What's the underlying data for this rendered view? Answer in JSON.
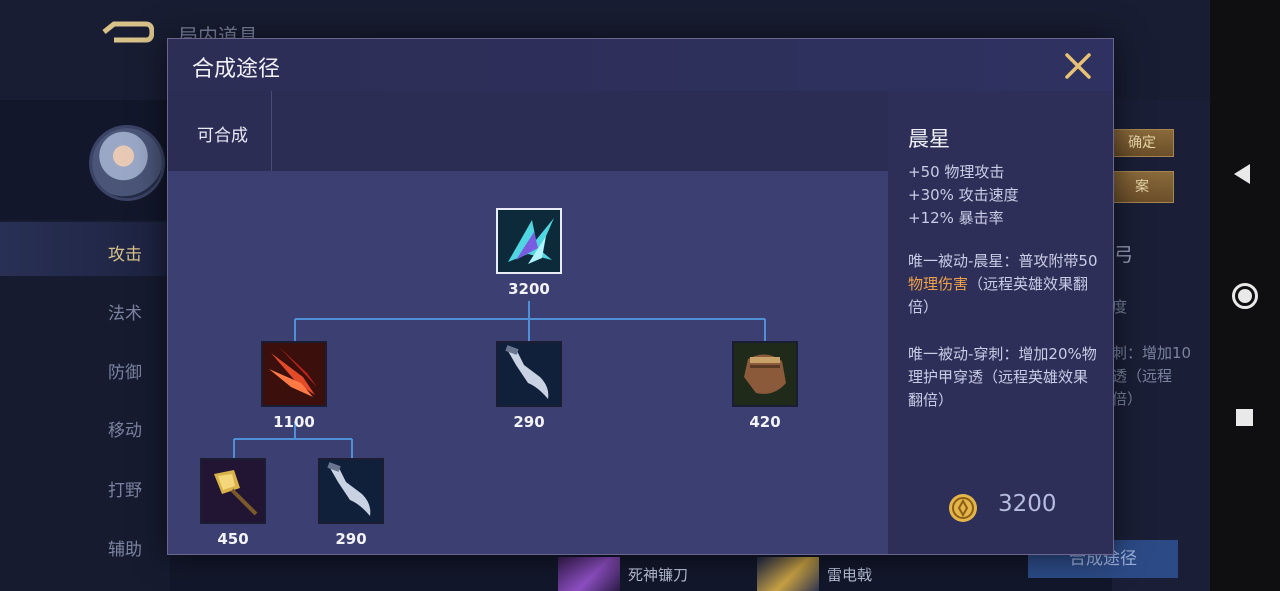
{
  "background": {
    "title": "局内道具",
    "categories": [
      "攻击",
      "法术",
      "防御",
      "移动",
      "打野",
      "辅助"
    ],
    "confirm_label": "确定",
    "plan_label": "案",
    "right_name_fragment": "弓",
    "right_stat_fragment": "度",
    "right_desc_fragments": [
      "刺：增加10",
      "透（远程",
      "倍）"
    ],
    "synth_button": "合成途径",
    "bottom_items": [
      {
        "name": "死神镰刀",
        "icon": "sickle-item-icon"
      },
      {
        "name": "雷电戟",
        "icon": "thunder-halberd-item-icon"
      }
    ]
  },
  "modal": {
    "title": "合成途径",
    "tab_label": "可合成",
    "item": {
      "name": "晨星",
      "stats": [
        "+50 物理攻击",
        "+30% 攻击速度",
        "+12% 暴击率"
      ],
      "passive1": {
        "prefix": "唯一被动-晨星：普攻附带50",
        "highlight": "物理伤害",
        "suffix": "（远程英雄效果翻倍）"
      },
      "passive2": "唯一被动-穿刺：增加20%物理护甲穿透（远程英雄效果翻倍）",
      "price": "3200"
    },
    "tree": {
      "root": {
        "icon": "morning-star-icon",
        "price": "3200"
      },
      "children": [
        {
          "icon": "red-claw-blade-icon",
          "price": "1100",
          "children": [
            {
              "icon": "golden-hammer-icon",
              "price": "450"
            },
            {
              "icon": "curved-dagger-icon",
              "price": "290"
            }
          ]
        },
        {
          "icon": "curved-dagger-icon",
          "price": "290"
        },
        {
          "icon": "brawler-fist-icon",
          "price": "420"
        }
      ]
    }
  },
  "colors": {
    "accent_gold": "#f0a24a",
    "close_icon": "#e8c274",
    "connector": "#4f8fd6"
  }
}
